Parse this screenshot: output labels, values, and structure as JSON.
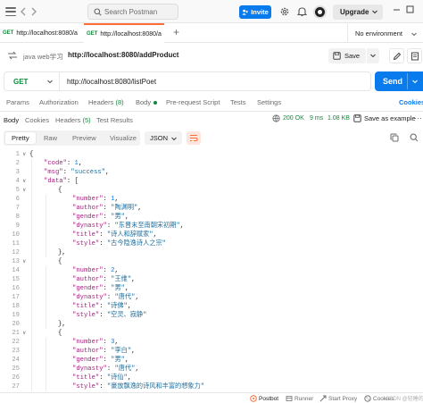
{
  "topbar": {
    "search_placeholder": "Search Postman",
    "invite_label": "Invite",
    "upgrade_label": "Upgrade"
  },
  "tabs": [
    {
      "method": "GET",
      "label": "http://localhost:8080/a"
    },
    {
      "method": "GET",
      "label": "http://localhost:8080/a"
    }
  ],
  "environment": {
    "selected": "No environment"
  },
  "breadcrumb": {
    "collection": "java web学习",
    "separator": "/",
    "request": "http://localhost:8080/addProduct"
  },
  "toolbar": {
    "save_label": "Save"
  },
  "request": {
    "method": "GET",
    "url": "http://localhost:8080/listPoet",
    "send_label": "Send",
    "tabs": {
      "params": "Params",
      "authorization": "Authorization",
      "headers": "Headers",
      "headers_count": "(8)",
      "body": "Body",
      "prerequest": "Pre-request Script",
      "tests": "Tests",
      "settings": "Settings"
    },
    "cookies_label": "Cookies"
  },
  "response": {
    "tabs": {
      "body": "Body",
      "cookies": "Cookies",
      "headers": "Headers",
      "headers_count": "(5)",
      "test_results": "Test Results"
    },
    "status": "200 OK",
    "time": "9 ms",
    "size": "1.08 KB",
    "save_example_label": "Save as example",
    "more": "···",
    "views": [
      "Pretty",
      "Raw",
      "Preview",
      "Visualize"
    ],
    "selected_view": "Pretty",
    "format": "JSON",
    "colors": {
      "status_ok": "#0f8a3c",
      "accent": "#097bed",
      "brand": "#ff6c37"
    },
    "lines": [
      {
        "n": "1",
        "fold": "∨",
        "indent": 0,
        "parts": [
          {
            "t": "p",
            "v": "{"
          }
        ]
      },
      {
        "n": "2",
        "indent": 1,
        "parts": [
          {
            "t": "k",
            "v": "\"code\""
          },
          {
            "t": "p",
            "v": ": "
          },
          {
            "t": "n",
            "v": "1"
          },
          {
            "t": "p",
            "v": ","
          }
        ]
      },
      {
        "n": "3",
        "indent": 1,
        "parts": [
          {
            "t": "k",
            "v": "\"msg\""
          },
          {
            "t": "p",
            "v": ": "
          },
          {
            "t": "s",
            "v": "\"success\""
          },
          {
            "t": "p",
            "v": ","
          }
        ]
      },
      {
        "n": "4",
        "fold": "∨",
        "indent": 1,
        "parts": [
          {
            "t": "k",
            "v": "\"data\""
          },
          {
            "t": "p",
            "v": ": ["
          }
        ]
      },
      {
        "n": "5",
        "fold": "∨",
        "indent": 2,
        "parts": [
          {
            "t": "p",
            "v": "{"
          }
        ]
      },
      {
        "n": "6",
        "indent": 3,
        "parts": [
          {
            "t": "k",
            "v": "\"number\""
          },
          {
            "t": "p",
            "v": ": "
          },
          {
            "t": "n",
            "v": "1"
          },
          {
            "t": "p",
            "v": ","
          }
        ]
      },
      {
        "n": "7",
        "indent": 3,
        "parts": [
          {
            "t": "k",
            "v": "\"author\""
          },
          {
            "t": "p",
            "v": ": "
          },
          {
            "t": "s",
            "v": "\"陶渊明\""
          },
          {
            "t": "p",
            "v": ","
          }
        ]
      },
      {
        "n": "8",
        "indent": 3,
        "parts": [
          {
            "t": "k",
            "v": "\"gender\""
          },
          {
            "t": "p",
            "v": ": "
          },
          {
            "t": "s",
            "v": "\"男\""
          },
          {
            "t": "p",
            "v": ","
          }
        ]
      },
      {
        "n": "9",
        "indent": 3,
        "parts": [
          {
            "t": "k",
            "v": "\"dynasty\""
          },
          {
            "t": "p",
            "v": ": "
          },
          {
            "t": "s",
            "v": "\"东晋末至南朝宋初期\""
          },
          {
            "t": "p",
            "v": ","
          }
        ]
      },
      {
        "n": "10",
        "indent": 3,
        "parts": [
          {
            "t": "k",
            "v": "\"title\""
          },
          {
            "t": "p",
            "v": ": "
          },
          {
            "t": "s",
            "v": "\"诗人和辞赋家\""
          },
          {
            "t": "p",
            "v": ","
          }
        ]
      },
      {
        "n": "11",
        "indent": 3,
        "parts": [
          {
            "t": "k",
            "v": "\"style\""
          },
          {
            "t": "p",
            "v": ": "
          },
          {
            "t": "s",
            "v": "\"古今隐逸诗人之宗\""
          }
        ]
      },
      {
        "n": "12",
        "indent": 2,
        "parts": [
          {
            "t": "p",
            "v": "},"
          }
        ]
      },
      {
        "n": "13",
        "fold": "∨",
        "indent": 2,
        "parts": [
          {
            "t": "p",
            "v": "{"
          }
        ]
      },
      {
        "n": "14",
        "indent": 3,
        "parts": [
          {
            "t": "k",
            "v": "\"number\""
          },
          {
            "t": "p",
            "v": ": "
          },
          {
            "t": "n",
            "v": "2"
          },
          {
            "t": "p",
            "v": ","
          }
        ]
      },
      {
        "n": "15",
        "indent": 3,
        "parts": [
          {
            "t": "k",
            "v": "\"author\""
          },
          {
            "t": "p",
            "v": ": "
          },
          {
            "t": "s",
            "v": "\"王维\""
          },
          {
            "t": "p",
            "v": ","
          }
        ]
      },
      {
        "n": "16",
        "indent": 3,
        "parts": [
          {
            "t": "k",
            "v": "\"gender\""
          },
          {
            "t": "p",
            "v": ": "
          },
          {
            "t": "s",
            "v": "\"男\""
          },
          {
            "t": "p",
            "v": ","
          }
        ]
      },
      {
        "n": "17",
        "indent": 3,
        "parts": [
          {
            "t": "k",
            "v": "\"dynasty\""
          },
          {
            "t": "p",
            "v": ": "
          },
          {
            "t": "s",
            "v": "\"唐代\""
          },
          {
            "t": "p",
            "v": ","
          }
        ]
      },
      {
        "n": "18",
        "indent": 3,
        "parts": [
          {
            "t": "k",
            "v": "\"title\""
          },
          {
            "t": "p",
            "v": ": "
          },
          {
            "t": "s",
            "v": "\"诗佛\""
          },
          {
            "t": "p",
            "v": ","
          }
        ]
      },
      {
        "n": "19",
        "indent": 3,
        "parts": [
          {
            "t": "k",
            "v": "\"style\""
          },
          {
            "t": "p",
            "v": ": "
          },
          {
            "t": "s",
            "v": "\"空灵、寂静\""
          }
        ]
      },
      {
        "n": "20",
        "indent": 2,
        "parts": [
          {
            "t": "p",
            "v": "},"
          }
        ]
      },
      {
        "n": "21",
        "fold": "∨",
        "indent": 2,
        "parts": [
          {
            "t": "p",
            "v": "{"
          }
        ]
      },
      {
        "n": "22",
        "indent": 3,
        "parts": [
          {
            "t": "k",
            "v": "\"number\""
          },
          {
            "t": "p",
            "v": ": "
          },
          {
            "t": "n",
            "v": "3"
          },
          {
            "t": "p",
            "v": ","
          }
        ]
      },
      {
        "n": "23",
        "indent": 3,
        "parts": [
          {
            "t": "k",
            "v": "\"author\""
          },
          {
            "t": "p",
            "v": ": "
          },
          {
            "t": "s",
            "v": "\"李白\""
          },
          {
            "t": "p",
            "v": ","
          }
        ]
      },
      {
        "n": "24",
        "indent": 3,
        "parts": [
          {
            "t": "k",
            "v": "\"gender\""
          },
          {
            "t": "p",
            "v": ": "
          },
          {
            "t": "s",
            "v": "\"男\""
          },
          {
            "t": "p",
            "v": ","
          }
        ]
      },
      {
        "n": "25",
        "indent": 3,
        "parts": [
          {
            "t": "k",
            "v": "\"dynasty\""
          },
          {
            "t": "p",
            "v": ": "
          },
          {
            "t": "s",
            "v": "\"唐代\""
          },
          {
            "t": "p",
            "v": ","
          }
        ]
      },
      {
        "n": "26",
        "indent": 3,
        "parts": [
          {
            "t": "k",
            "v": "\"title\""
          },
          {
            "t": "p",
            "v": ": "
          },
          {
            "t": "s",
            "v": "\"诗仙\""
          },
          {
            "t": "p",
            "v": ","
          }
        ]
      },
      {
        "n": "27",
        "indent": 3,
        "parts": [
          {
            "t": "k",
            "v": "\"style\""
          },
          {
            "t": "p",
            "v": ": "
          },
          {
            "t": "s",
            "v": "\"豪放飘逸的诗风和丰富的想象力\""
          }
        ]
      }
    ]
  },
  "statusbar": {
    "postbot": "Postbot",
    "runner": "Runner",
    "start_proxy": "Start Proxy",
    "cookies": "Cookies",
    "watermark": "CSDN @轻睡的一"
  }
}
